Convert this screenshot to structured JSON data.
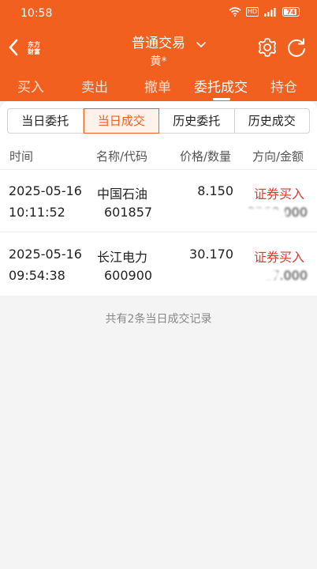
{
  "status_bar": {
    "time": "10:58",
    "hd": "HD",
    "battery": "74"
  },
  "nav": {
    "logo_top": "东方",
    "logo_bottom": "财富",
    "title": "普通交易",
    "subtitle": "黄*"
  },
  "main_tabs": [
    {
      "label": "买入"
    },
    {
      "label": "卖出"
    },
    {
      "label": "撤单"
    },
    {
      "label": "委托成交"
    },
    {
      "label": "持仓"
    }
  ],
  "segments": [
    {
      "label": "当日委托"
    },
    {
      "label": "当日成交"
    },
    {
      "label": "历史委托"
    },
    {
      "label": "历史成交"
    }
  ],
  "columns": {
    "time": "时间",
    "name_code": "名称/代码",
    "price_qty": "价格/数量",
    "dir_amount": "方向/金额"
  },
  "rows": [
    {
      "date": "2025-05-16",
      "time": "10:11:52",
      "name": "中国石油",
      "code": "601857",
      "price": "8.150",
      "direction": "证券买入",
      "amount": "3260.000"
    },
    {
      "date": "2025-05-16",
      "time": "09:54:38",
      "name": "长江电力",
      "code": "600900",
      "price": "30.170",
      "direction": "证券买入",
      "amount": "3017.000"
    }
  ],
  "footer_note": "共有2条当日成交记录",
  "colors": {
    "brand": "#f2601f",
    "buy": "#e0382d"
  }
}
